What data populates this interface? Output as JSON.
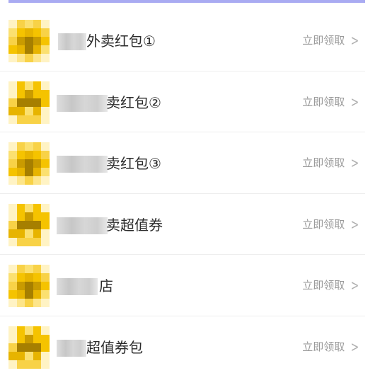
{
  "colors": {
    "top_bar": "#a9abf2",
    "icon_yellow": "#f5c300",
    "title_text": "#2b2b2b",
    "action_text": "#9a9a9a"
  },
  "list": {
    "items": [
      {
        "title": "外卖红包①",
        "action": "立即领取",
        "icon": "coupon-icon",
        "chevron": "chevron-right-icon"
      },
      {
        "title": "卖红包②",
        "action": "立即领取",
        "icon": "coupon-icon",
        "chevron": "chevron-right-icon"
      },
      {
        "title": "卖红包③",
        "action": "立即领取",
        "icon": "coupon-icon",
        "chevron": "chevron-right-icon"
      },
      {
        "title": "卖超值券",
        "action": "立即领取",
        "icon": "coupon-icon",
        "chevron": "chevron-right-icon"
      },
      {
        "title": "店",
        "action": "立即领取",
        "icon": "coupon-icon",
        "chevron": "chevron-right-icon"
      },
      {
        "title": "超值券包",
        "action": "立即领取",
        "icon": "coupon-icon",
        "chevron": "chevron-right-icon"
      }
    ]
  }
}
